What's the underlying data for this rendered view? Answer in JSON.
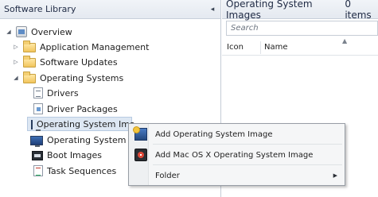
{
  "nav": {
    "title": "Software Library",
    "collapse_glyph": "◂",
    "tree": [
      {
        "label": "Overview",
        "icon": "overview-icon",
        "expander": "◢"
      },
      {
        "label": "Application Management",
        "icon": "folder-icon",
        "expander": "▷"
      },
      {
        "label": "Software Updates",
        "icon": "folder-icon",
        "expander": "▷"
      },
      {
        "label": "Operating Systems",
        "icon": "folder-icon",
        "expander": "◢"
      },
      {
        "label": "Drivers",
        "icon": "driver-icon"
      },
      {
        "label": "Driver Packages",
        "icon": "driver-package-icon"
      },
      {
        "label": "Operating System Ima",
        "icon": "os-image-icon",
        "selected": true
      },
      {
        "label": "Operating System Ins",
        "icon": "os-installer-icon"
      },
      {
        "label": "Boot Images",
        "icon": "boot-image-icon"
      },
      {
        "label": "Task Sequences",
        "icon": "task-sequence-icon"
      }
    ]
  },
  "content": {
    "title": "Operating System Images",
    "count": "0 items",
    "search_placeholder": "Search",
    "columns": [
      "Icon",
      "Name"
    ]
  },
  "context_menu": {
    "items": [
      {
        "label": "Add Operating System Image",
        "icon": "add-os-image-icon"
      },
      {
        "label": "Add Mac OS X Operating System Image",
        "icon": "add-mac-os-image-icon"
      },
      {
        "label": "Folder",
        "submenu": "▶"
      }
    ]
  }
}
